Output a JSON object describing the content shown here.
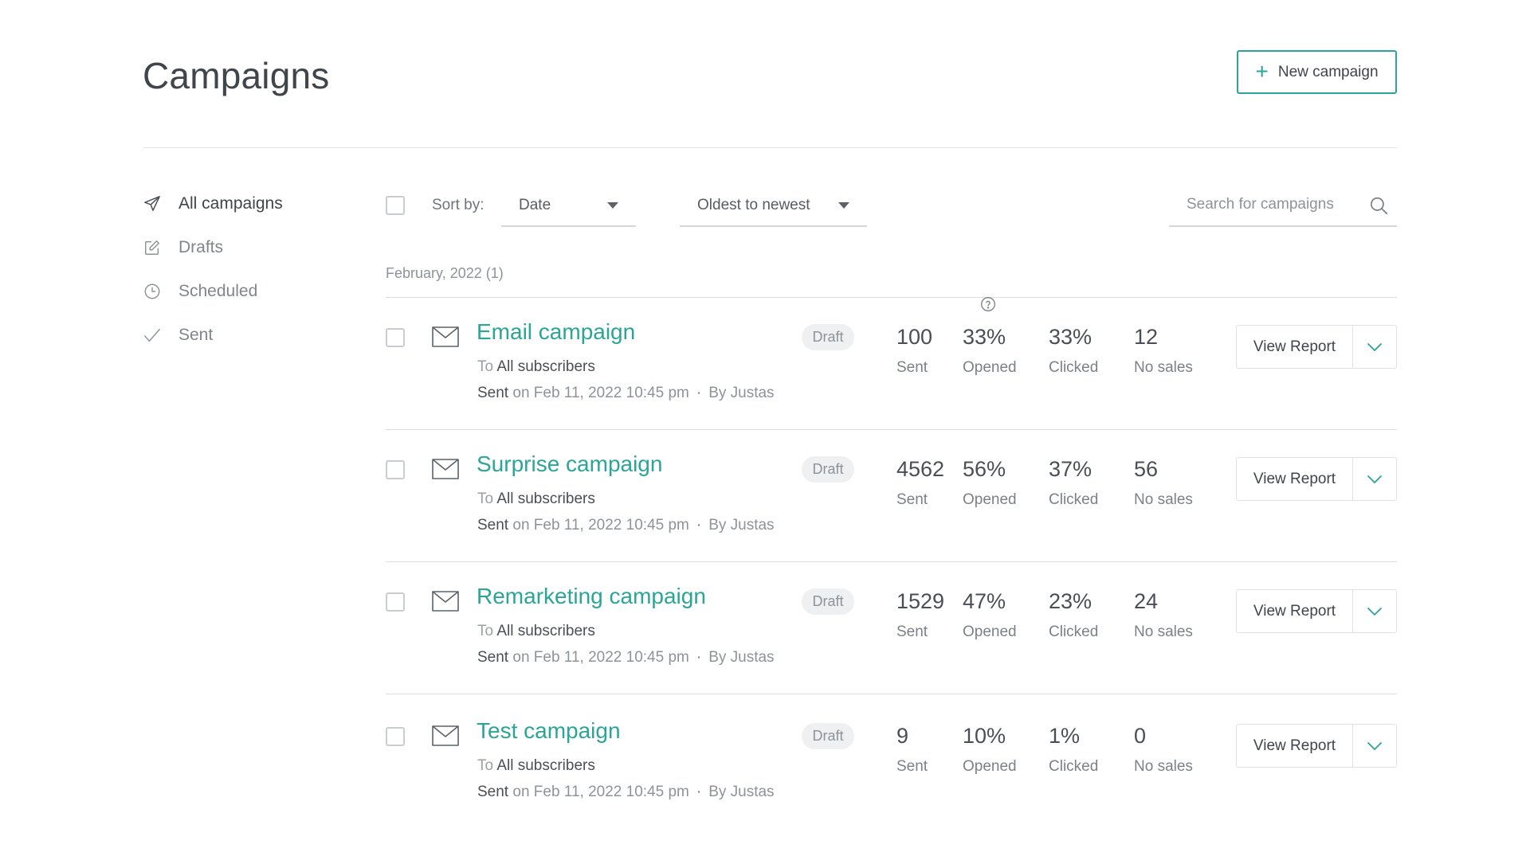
{
  "header": {
    "title": "Campaigns",
    "new_campaign_label": "New campaign"
  },
  "sidebar": {
    "items": [
      {
        "label": "All campaigns",
        "icon": "send-icon",
        "active": true
      },
      {
        "label": "Drafts",
        "icon": "edit-icon",
        "active": false
      },
      {
        "label": "Scheduled",
        "icon": "clock-icon",
        "active": false
      },
      {
        "label": "Sent",
        "icon": "check-icon",
        "active": false
      }
    ]
  },
  "toolbar": {
    "sort_label": "Sort by:",
    "sort_field": "Date",
    "sort_order": "Oldest to newest",
    "search_placeholder": "Search for campaigns"
  },
  "group": {
    "label": "February, 2022 (1)"
  },
  "stat_labels": {
    "sent": "Sent",
    "opened": "Opened",
    "clicked": "Clicked",
    "sales": "No sales"
  },
  "campaigns": [
    {
      "name": "Email campaign",
      "to_prefix": "To",
      "to": "All subscribers",
      "sent_prefix": "Sent",
      "sent_date": "on Feb 11, 2022 10:45 pm",
      "dot": "·",
      "by": "By Justas",
      "badge": "Draft",
      "sent": "100",
      "opened": "33%",
      "clicked": "33%",
      "sales": "12",
      "action": "View Report"
    },
    {
      "name": "Surprise campaign",
      "to_prefix": "To",
      "to": "All subscribers",
      "sent_prefix": "Sent",
      "sent_date": "on Feb 11, 2022 10:45 pm",
      "dot": "·",
      "by": "By Justas",
      "badge": "Draft",
      "sent": "4562",
      "opened": "56%",
      "clicked": "37%",
      "sales": "56",
      "action": "View Report"
    },
    {
      "name": "Remarketing campaign",
      "to_prefix": "To",
      "to": "All subscribers",
      "sent_prefix": "Sent",
      "sent_date": "on Feb 11, 2022 10:45 pm",
      "dot": "·",
      "by": "By Justas",
      "badge": "Draft",
      "sent": "1529",
      "opened": "47%",
      "clicked": "23%",
      "sales": "24",
      "action": "View Report"
    },
    {
      "name": "Test campaign",
      "to_prefix": "To",
      "to": "All subscribers",
      "sent_prefix": "Sent",
      "sent_date": "on Feb 11, 2022 10:45 pm",
      "dot": "·",
      "by": "By Justas",
      "badge": "Draft",
      "sent": "9",
      "opened": "10%",
      "clicked": "1%",
      "sales": "0",
      "action": "View Report"
    }
  ],
  "colors": {
    "accent": "#2aa597",
    "text": "#4a4f55",
    "muted": "#8d9399",
    "divider": "#dcdfe2"
  }
}
